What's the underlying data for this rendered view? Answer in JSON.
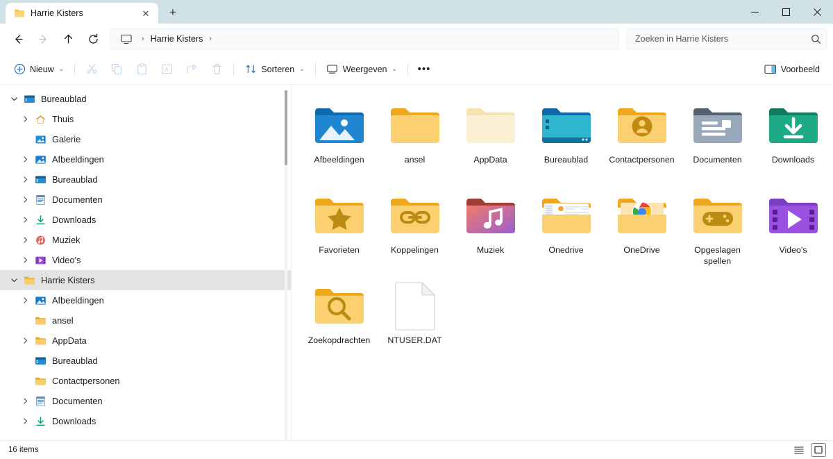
{
  "window": {
    "titlebar_color": "#cfe1e7",
    "tab": {
      "title": "Harrie Kisters",
      "close_label": "✕"
    },
    "new_tab_label": "+",
    "controls": {
      "minimize": "Minimaliseren",
      "maximize": "Maximaliseren",
      "close": "Sluiten"
    }
  },
  "addressbar": {
    "back": "Terug",
    "forward": "Vooruit",
    "up": "Omhoog",
    "refresh": "Vernieuwen",
    "breadcrumb": {
      "root_icon": "monitor-icon",
      "sep": "›",
      "path": "Harrie Kisters",
      "trailing_sep": "›"
    },
    "search": {
      "placeholder": "Zoeken in Harrie Kisters",
      "icon": "search-icon"
    }
  },
  "toolbar": {
    "new_label": "Nieuw",
    "chevron": "⌄",
    "cut": "Knippen",
    "copy": "Kopiëren",
    "paste": "Plakken",
    "rename": "Naam wijzigen",
    "share": "Delen",
    "delete": "Verwijderen",
    "sort_label": "Sorteren",
    "view_label": "Weergeven",
    "overflow_label": "•••",
    "preview_label": "Voorbeeld"
  },
  "sidebar": {
    "items": [
      {
        "label": "Bureaublad",
        "icon": "desktop-icon",
        "indent": 0,
        "twisty": "open",
        "selected": false
      },
      {
        "label": "Thuis",
        "icon": "home-icon",
        "indent": 1,
        "twisty": "closed",
        "selected": false
      },
      {
        "label": "Galerie",
        "icon": "gallery-icon",
        "indent": 1,
        "twisty": "none",
        "selected": false
      },
      {
        "label": "Afbeeldingen",
        "icon": "pictures-icon",
        "indent": 1,
        "twisty": "closed",
        "selected": false
      },
      {
        "label": "Bureaublad",
        "icon": "desktop-icon",
        "indent": 1,
        "twisty": "closed",
        "selected": false
      },
      {
        "label": "Documenten",
        "icon": "documents-icon",
        "indent": 1,
        "twisty": "closed",
        "selected": false
      },
      {
        "label": "Downloads",
        "icon": "downloads-icon",
        "indent": 1,
        "twisty": "closed",
        "selected": false
      },
      {
        "label": "Muziek",
        "icon": "music-icon",
        "indent": 1,
        "twisty": "closed",
        "selected": false
      },
      {
        "label": "Video's",
        "icon": "videos-icon",
        "indent": 1,
        "twisty": "closed",
        "selected": false
      },
      {
        "label": "Harrie Kisters",
        "icon": "folder-icon",
        "indent": 0,
        "twisty": "open",
        "selected": true
      },
      {
        "label": "Afbeeldingen",
        "icon": "pictures-icon",
        "indent": 1,
        "twisty": "closed",
        "selected": false
      },
      {
        "label": "ansel",
        "icon": "folder-icon",
        "indent": 1,
        "twisty": "none",
        "selected": false
      },
      {
        "label": "AppData",
        "icon": "folder-icon",
        "indent": 1,
        "twisty": "closed",
        "selected": false
      },
      {
        "label": "Bureaublad",
        "icon": "desktop-icon",
        "indent": 1,
        "twisty": "none",
        "selected": false
      },
      {
        "label": "Contactpersonen",
        "icon": "folder-icon",
        "indent": 1,
        "twisty": "none",
        "selected": false
      },
      {
        "label": "Documenten",
        "icon": "documents-icon",
        "indent": 1,
        "twisty": "closed",
        "selected": false
      },
      {
        "label": "Downloads",
        "icon": "downloads-icon",
        "indent": 1,
        "twisty": "closed",
        "selected": false
      }
    ]
  },
  "files": [
    {
      "name": "Afbeeldingen",
      "icon": "pictures-folder-icon"
    },
    {
      "name": "ansel",
      "icon": "folder-icon"
    },
    {
      "name": "AppData",
      "icon": "folder-hidden-icon"
    },
    {
      "name": "Bureaublad",
      "icon": "desktop-folder-icon"
    },
    {
      "name": "Contactpersonen",
      "icon": "contacts-folder-icon"
    },
    {
      "name": "Documenten",
      "icon": "documents-folder-icon"
    },
    {
      "name": "Downloads",
      "icon": "downloads-folder-icon"
    },
    {
      "name": "Favorieten",
      "icon": "favorites-folder-icon"
    },
    {
      "name": "Koppelingen",
      "icon": "links-folder-icon"
    },
    {
      "name": "Muziek",
      "icon": "music-folder-icon"
    },
    {
      "name": "Onedrive",
      "icon": "folder-thumbnail-icon"
    },
    {
      "name": "OneDrive",
      "icon": "folder-chrome-icon"
    },
    {
      "name": "Opgeslagen spellen",
      "icon": "games-folder-icon"
    },
    {
      "name": "Video's",
      "icon": "videos-folder-icon"
    },
    {
      "name": "Zoekopdrachten",
      "icon": "searches-folder-icon"
    },
    {
      "name": "NTUSER.DAT",
      "icon": "blank-document-icon"
    }
  ],
  "statusbar": {
    "item_count": "16 items",
    "details_view": "Detailsweergave",
    "icons_view": "Grote pictogrammen"
  }
}
